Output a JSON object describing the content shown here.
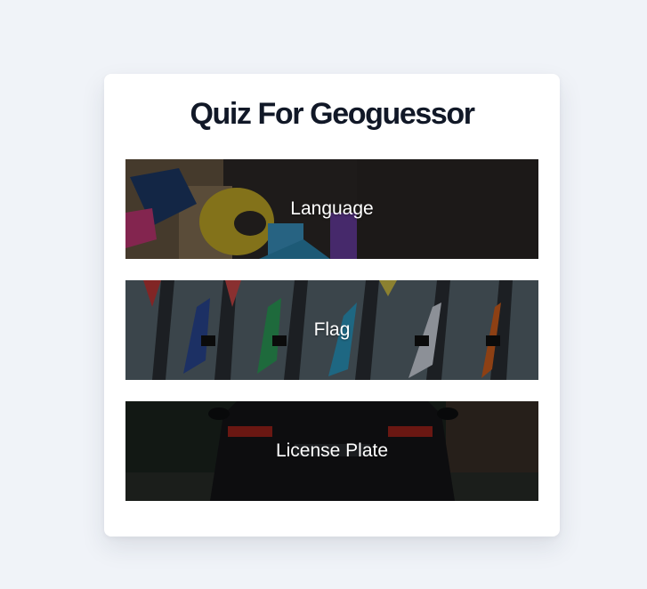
{
  "page": {
    "background": "#f0f3f8"
  },
  "card": {
    "title": "Quiz For Geoguessor",
    "quizzes": [
      {
        "label": "Language",
        "image": "colorful-letters-photo"
      },
      {
        "label": "Flag",
        "image": "flags-on-wall-photo"
      },
      {
        "label": "License Plate",
        "image": "car-rear-photo"
      }
    ]
  }
}
